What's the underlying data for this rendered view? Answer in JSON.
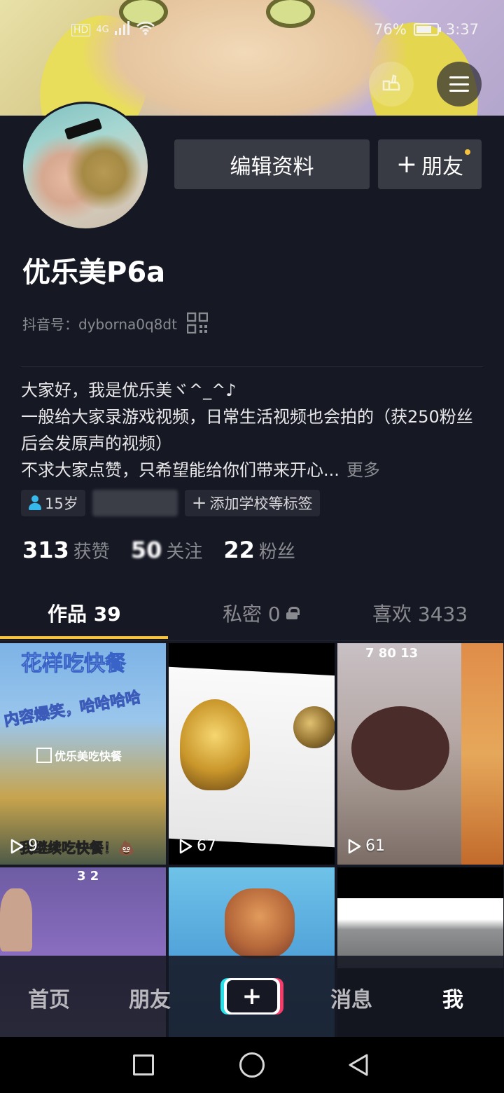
{
  "status_bar": {
    "network": "HD",
    "signal": "4G",
    "battery_percent": "76%",
    "battery_level": 0.76,
    "time": "3:37"
  },
  "header": {
    "tip_icon": "hand-pointer-icon",
    "menu_icon": "hamburger-menu-icon"
  },
  "profile": {
    "edit_button": "编辑资料",
    "add_friend_button": "朋友",
    "add_friend_plus": "+",
    "nickname": "优乐美P6a",
    "douyin_id": "抖音号：dyborna0q8dt",
    "bio_lines": [
      "大家好，我是优乐美ヾ^_^♪",
      "一般给大家录游戏视频，日常生活视频也会拍的（获250粉丝后会发原声的视频）",
      "不求大家点赞，只希望能给你们带来开心..."
    ],
    "bio_more": "更多",
    "tags": {
      "age": "15岁",
      "add_school": "添加学校等标签",
      "add_plus": "+"
    }
  },
  "stats": {
    "likes_num": "313",
    "likes_label": "获赞",
    "following_num": "50",
    "following_label": "关注",
    "followers_num": "22",
    "followers_label": "粉丝"
  },
  "tabs": {
    "works": "作品 39",
    "private": "私密 0",
    "likes": "喜欢 3433"
  },
  "videos": [
    {
      "plays": "9",
      "cap1": "花样吃快餐",
      "cap2": "内容爆笑，哈哈哈哈",
      "cap3": "优乐美吃快餐",
      "cap4": "我继续吃快餐！💩"
    },
    {
      "plays": "67"
    },
    {
      "plays": "61",
      "hud": "7  80  13"
    },
    {
      "hud": "3  2"
    },
    {},
    {}
  ],
  "bottom_nav": {
    "home": "首页",
    "friends": "朋友",
    "create": "+",
    "messages": "消息",
    "me": "我"
  },
  "colors": {
    "background": "#161823",
    "accent": "#f7c33c",
    "button_bg": "#393b44",
    "age_icon": "#36b9ea"
  }
}
